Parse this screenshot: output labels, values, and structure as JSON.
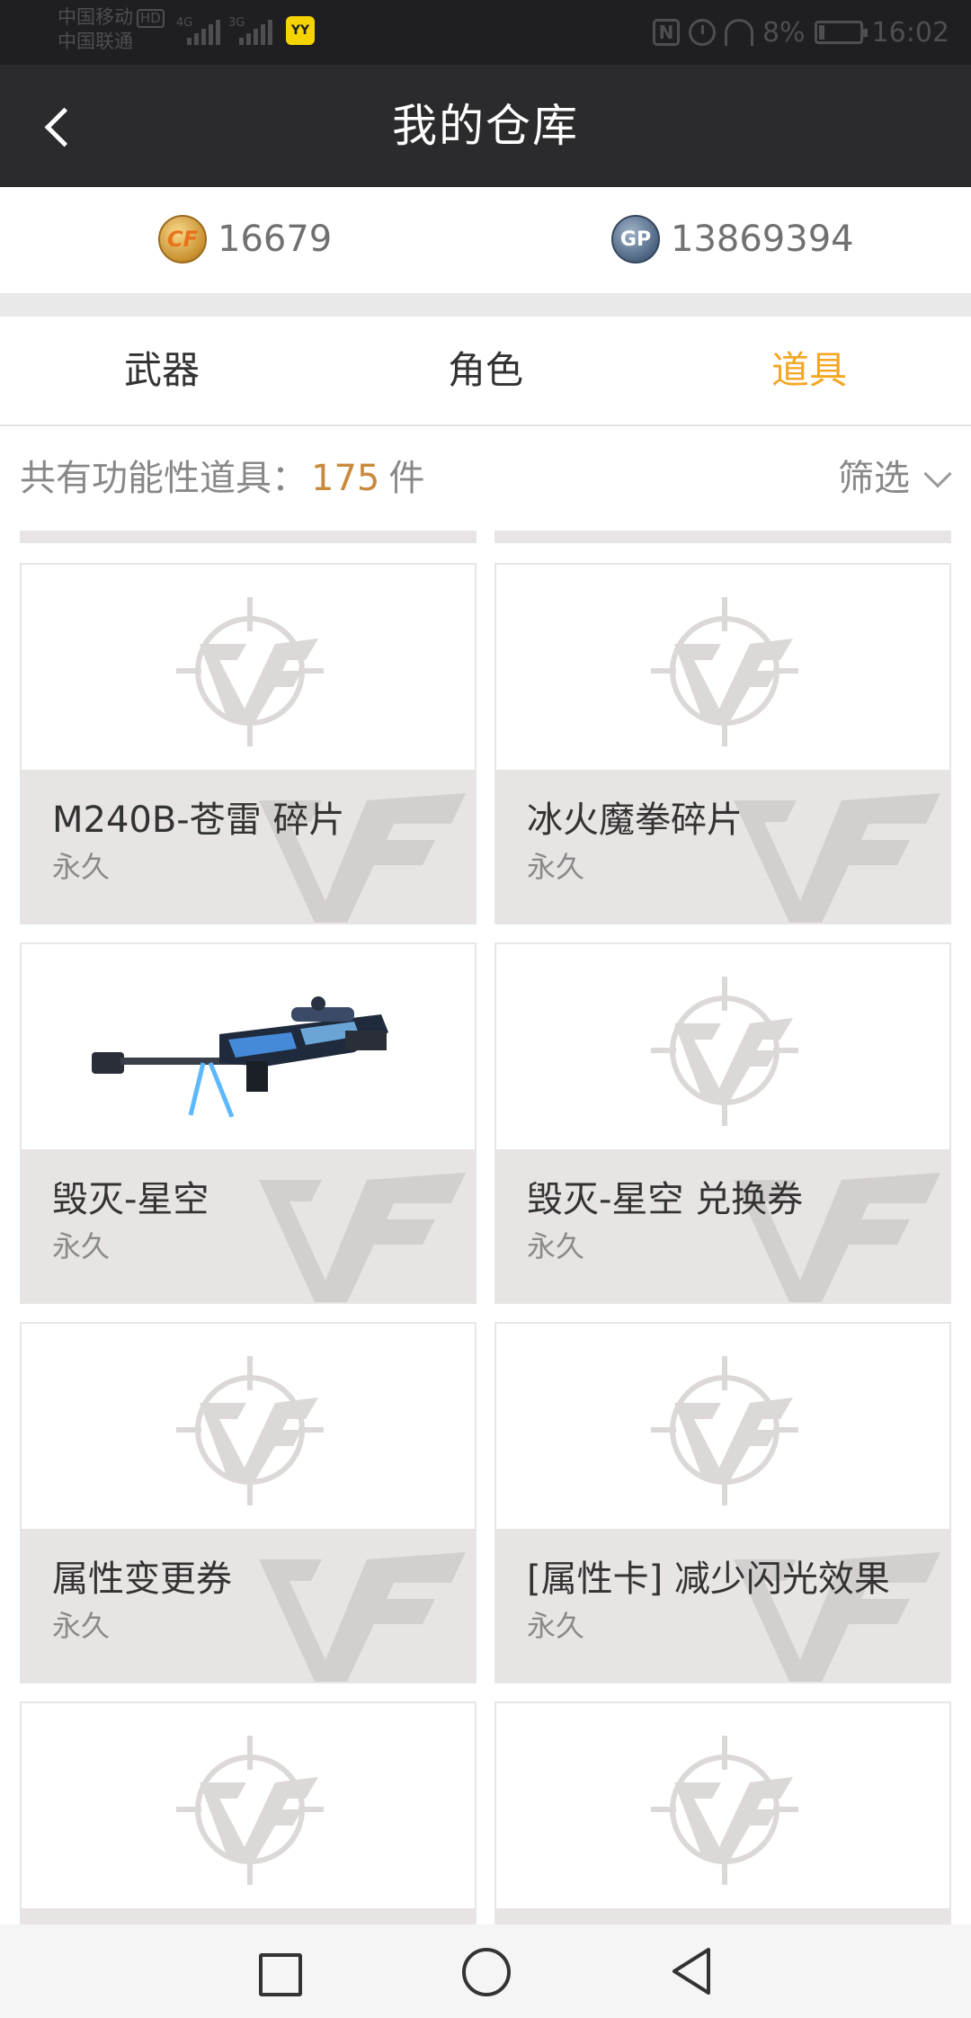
{
  "status_bar": {
    "carrier_1": "中国移动",
    "carrier_1_badge": "HD",
    "carrier_2": "中国联通",
    "net_1": "4G",
    "net_2": "3G",
    "app_badge": "YY",
    "nfc": "N",
    "battery_text": "8%",
    "time": "16:02"
  },
  "header": {
    "title": "我的仓库",
    "back_icon": "chevron-left-icon"
  },
  "currency": {
    "cf_points": "16679",
    "cf_icon": "cf-coin-icon",
    "cf_icon_label": "CF",
    "gp_points": "13869394",
    "gp_icon": "gp-coin-icon",
    "gp_icon_label": "GP"
  },
  "tabs": [
    {
      "label": "武器",
      "active": false
    },
    {
      "label": "角色",
      "active": false
    },
    {
      "label": "道具",
      "active": true
    }
  ],
  "colors": {
    "accent": "#f5a623",
    "count": "#c98a3c",
    "header_bg": "#2b2b2e"
  },
  "summary": {
    "label": "共有功能性道具：",
    "count": "175",
    "unit": "件",
    "filter_label": "筛选"
  },
  "items": [
    {
      "name": "M240B-苍雷 碎片",
      "duration": "永久",
      "image": "cf-placeholder-logo"
    },
    {
      "name": "冰火魔拳碎片",
      "duration": "永久",
      "image": "cf-placeholder-logo"
    },
    {
      "name": "毁灭-星空",
      "duration": "永久",
      "image": "sniper-rifle-image"
    },
    {
      "name": "毁灭-星空 兑换券",
      "duration": "永久",
      "image": "cf-placeholder-logo"
    },
    {
      "name": "属性变更券",
      "duration": "永久",
      "image": "cf-placeholder-logo"
    },
    {
      "name": "[属性卡] 减少闪光效果",
      "duration": "永久",
      "image": "cf-placeholder-logo"
    }
  ],
  "nav": {
    "recent": "square-icon",
    "home": "circle-icon",
    "back": "triangle-back-icon"
  }
}
